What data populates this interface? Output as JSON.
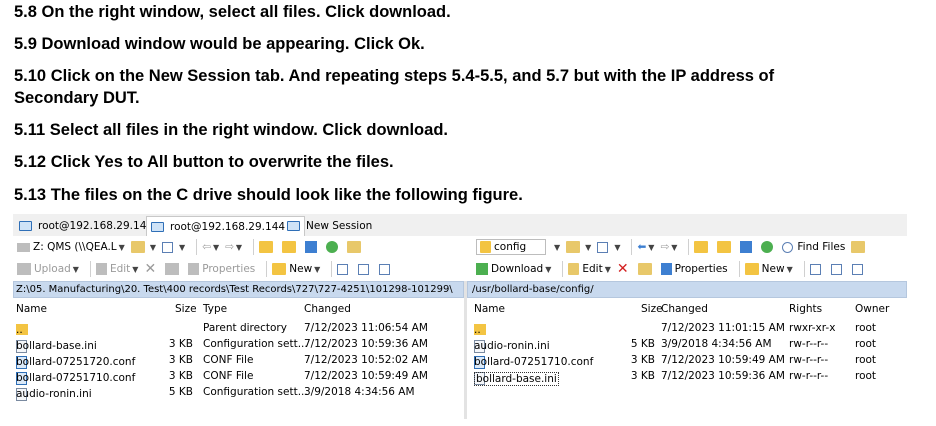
{
  "steps": [
    "5.8 On the right window, select all files. Click download.",
    "5.9 Download window would be appearing. Click Ok.",
    "5.10 Click on the New Session tab. And repeating steps 5.4-5.5, and 5.7 but with the IP address of",
    "Secondary DUT.",
    "5.11 Select all files in the right window. Click download.",
    "5.12 Click Yes to All button to overwrite the files.",
    "5.13 The files on the C drive should look like the following figure."
  ],
  "tabs": [
    {
      "label": "root@192.168.29.143",
      "close": "×"
    },
    {
      "label": "root@192.168.29.144",
      "close": "×"
    },
    {
      "label": "New Session"
    }
  ],
  "left": {
    "drive": "Z: QMS (\\\\QEA.L",
    "upload": "Upload",
    "edit": "Edit",
    "properties": "Properties",
    "new": "New",
    "path": "Z:\\05. Manufacturing\\20. Test\\400 records\\Test Records\\727\\727-4251\\101298-101299\\",
    "columns": [
      "Name",
      "Size",
      "Type",
      "Changed"
    ],
    "rows": [
      {
        "name": "..",
        "size": "",
        "type": "Parent directory",
        "changed": "7/12/2023  11:06:54 AM",
        "up": true
      },
      {
        "name": "bollard-base.ini",
        "size": "3 KB",
        "type": "Configuration sett...",
        "changed": "7/12/2023  10:59:36 AM"
      },
      {
        "name": "bollard-07251720.conf",
        "size": "3 KB",
        "type": "CONF File",
        "changed": "7/12/2023  10:52:02 AM"
      },
      {
        "name": "bollard-07251710.conf",
        "size": "3 KB",
        "type": "CONF File",
        "changed": "7/12/2023  10:59:49 AM"
      },
      {
        "name": "audio-ronin.ini",
        "size": "5 KB",
        "type": "Configuration sett...",
        "changed": "3/9/2018  4:34:56 AM"
      }
    ]
  },
  "right": {
    "folder": "config",
    "find": "Find Files",
    "download": "Download",
    "edit": "Edit",
    "properties": "Properties",
    "new": "New",
    "path": "/usr/bollard-base/config/",
    "columns": [
      "Name",
      "Size",
      "Changed",
      "Rights",
      "Owner"
    ],
    "rows": [
      {
        "name": "..",
        "size": "",
        "changed": "7/12/2023  11:01:15 AM",
        "rights": "rwxr-xr-x",
        "owner": "root",
        "up": true
      },
      {
        "name": "audio-ronin.ini",
        "size": "5 KB",
        "changed": "3/9/2018  4:34:56 AM",
        "rights": "rw-r--r--",
        "owner": "root"
      },
      {
        "name": "bollard-07251710.conf",
        "size": "3 KB",
        "changed": "7/12/2023  10:59:49 AM",
        "rights": "rw-r--r--",
        "owner": "root"
      },
      {
        "name": "bollard-base.ini",
        "size": "3 KB",
        "changed": "7/12/2023  10:59:36 AM",
        "rights": "rw-r--r--",
        "owner": "root"
      }
    ]
  }
}
